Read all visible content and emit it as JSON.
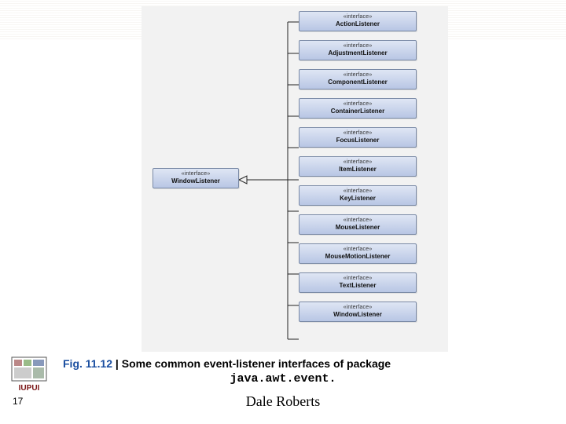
{
  "stereotype": "«interface»",
  "stereotype_alt": "«interface»",
  "parent": {
    "name": "WindowListener"
  },
  "children": [
    {
      "name": "ActionListener"
    },
    {
      "name": "AdjustmentListener"
    },
    {
      "name": "ComponentListener"
    },
    {
      "name": "ContainerListener"
    },
    {
      "name": "FocusListener"
    },
    {
      "name": "ItemListener"
    },
    {
      "name": "KeyListener"
    },
    {
      "name": "MouseListener"
    },
    {
      "name": "MouseMotionListener"
    },
    {
      "name": "TextListener"
    },
    {
      "name": "WindowListener"
    }
  ],
  "caption": {
    "fig_ref": "Fig. 11.12",
    "separator": " | ",
    "text": "Some common event-listener interfaces of package"
  },
  "package_name": "java.awt.event.",
  "slide_number": "17",
  "author": "Dale Roberts",
  "iupui": "IUPUI"
}
